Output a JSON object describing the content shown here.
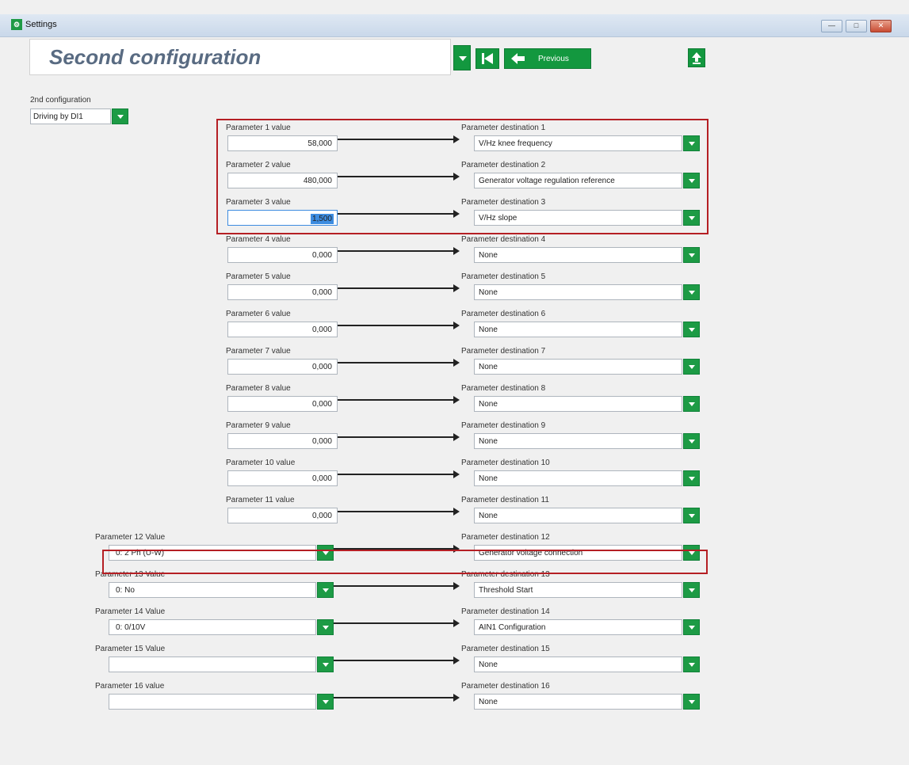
{
  "window": {
    "title": "Settings",
    "app_icon": "settings-app-icon",
    "minimize": "—",
    "maximize": "□",
    "close": "✕"
  },
  "header": {
    "title": "Second configuration",
    "previous_label": "Previous"
  },
  "config": {
    "label": "2nd configuration",
    "value": "Driving by DI1"
  },
  "parameters": [
    {
      "value_label": "Parameter 1 value",
      "value": "58,000",
      "dest_label": "Parameter destination 1",
      "dest": "V/Hz knee frequency"
    },
    {
      "value_label": "Parameter 2 value",
      "value": "480,000",
      "dest_label": "Parameter destination 2",
      "dest": "Generator voltage regulation reference"
    },
    {
      "value_label": "Parameter 3 value",
      "value": "1,500",
      "dest_label": "Parameter destination 3",
      "dest": "V/Hz slope"
    },
    {
      "value_label": "Parameter 4 value",
      "value": "0,000",
      "dest_label": "Parameter destination 4",
      "dest": "None"
    },
    {
      "value_label": "Parameter 5 value",
      "value": "0,000",
      "dest_label": "Parameter destination 5",
      "dest": "None"
    },
    {
      "value_label": "Parameter 6 value",
      "value": "0,000",
      "dest_label": "Parameter destination 6",
      "dest": "None"
    },
    {
      "value_label": "Parameter 7 value",
      "value": "0,000",
      "dest_label": "Parameter destination 7",
      "dest": "None"
    },
    {
      "value_label": "Parameter 8 value",
      "value": "0,000",
      "dest_label": "Parameter destination 8",
      "dest": "None"
    },
    {
      "value_label": "Parameter 9 value",
      "value": "0,000",
      "dest_label": "Parameter destination 9",
      "dest": "None"
    },
    {
      "value_label": "Parameter 10 value",
      "value": "0,000",
      "dest_label": "Parameter destination 10",
      "dest": "None"
    },
    {
      "value_label": "Parameter 11 value",
      "value": "0,000",
      "dest_label": "Parameter destination 11",
      "dest": "None"
    },
    {
      "value_label": "Parameter 12 Value",
      "value": "0: 2 Ph (U-W)",
      "dest_label": "Parameter destination 12",
      "dest": "Generator voltage connection"
    },
    {
      "value_label": "Parameter 13 Value",
      "value": "0: No",
      "dest_label": "Parameter destination 13",
      "dest": "Threshold Start"
    },
    {
      "value_label": "Parameter 14 Value",
      "value": "0: 0/10V",
      "dest_label": "Parameter destination 14",
      "dest": "AIN1 Configuration"
    },
    {
      "value_label": "Parameter 15 Value",
      "value": "",
      "dest_label": "Parameter destination 15",
      "dest": "None"
    },
    {
      "value_label": "Parameter 16 value",
      "value": "",
      "dest_label": "Parameter destination 16",
      "dest": "None"
    }
  ],
  "colors": {
    "accent_green": "#13983f",
    "highlight_red": "#b51f24",
    "title_text": "#596b82"
  }
}
